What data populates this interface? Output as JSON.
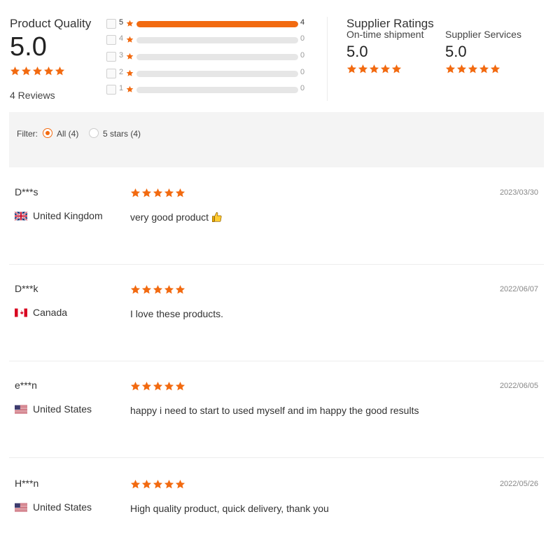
{
  "product_quality": {
    "title": "Product Quality",
    "score": "5.0",
    "stars": 5,
    "reviews_label": "4 Reviews"
  },
  "distribution": [
    {
      "stars": "5",
      "count": "4",
      "fraction": 1.0
    },
    {
      "stars": "4",
      "count": "0",
      "fraction": 0
    },
    {
      "stars": "3",
      "count": "0",
      "fraction": 0
    },
    {
      "stars": "2",
      "count": "0",
      "fraction": 0
    },
    {
      "stars": "1",
      "count": "0",
      "fraction": 0
    }
  ],
  "supplier": {
    "title": "Supplier Ratings",
    "ratings": [
      {
        "label": "On-time shipment",
        "score": "5.0",
        "stars": 5
      },
      {
        "label": "Supplier Services",
        "score": "5.0",
        "stars": 5
      }
    ]
  },
  "filter": {
    "label": "Filter:",
    "options": [
      {
        "label": "All (4)",
        "checked": true
      },
      {
        "label": "5 stars (4)",
        "checked": false
      }
    ]
  },
  "reviews": [
    {
      "name": "D***s",
      "country": "United Kingdom",
      "flag": "uk-flag",
      "stars": 5,
      "date": "2023/03/30",
      "text": "very good product",
      "emoji": "thumbs-up-icon"
    },
    {
      "name": "D***k",
      "country": "Canada",
      "flag": "canada-flag",
      "stars": 5,
      "date": "2022/06/07",
      "text": "I love these products."
    },
    {
      "name": "e***n",
      "country": "United States",
      "flag": "us-flag",
      "stars": 5,
      "date": "2022/06/05",
      "text": "happy i need to start to used myself and im happy the good results"
    },
    {
      "name": "H***n",
      "country": "United States",
      "flag": "us-flag",
      "stars": 5,
      "date": "2022/05/26",
      "text": "High quality product, quick delivery, thank you"
    }
  ],
  "colors": {
    "accent": "#f26a10",
    "track": "#e6e6e6",
    "filter_bg": "#f4f4f4"
  }
}
